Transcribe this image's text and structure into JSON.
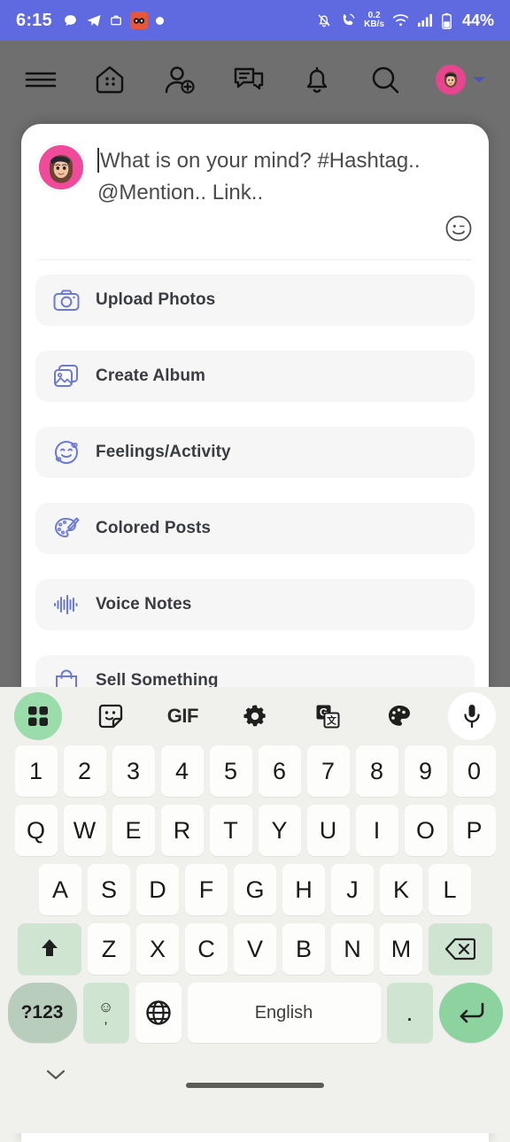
{
  "status_bar": {
    "time": "6:15",
    "network_speed": "0.2",
    "network_speed_unit": "KB/s",
    "battery": "44%",
    "background_color": "#5f6ae0",
    "left_icons": [
      "chat-bubble-icon",
      "telegram-icon",
      "camera-app-icon",
      "orange-app-icon",
      "dot-icon"
    ],
    "right_icons": [
      "bell-muted-icon",
      "call-icon",
      "network-speed",
      "wifi-icon",
      "signal-icon",
      "battery-icon"
    ]
  },
  "app_header": {
    "icons": [
      "menu-icon",
      "home-icon",
      "add-friend-icon",
      "messages-icon",
      "notifications-icon",
      "search-icon"
    ],
    "avatar": "user-avatar",
    "chevron": "chevron-down-icon"
  },
  "compose": {
    "placeholder": "What is on your mind? #Hashtag.. @Mention.. Link..",
    "placeholder_line1": "What is on your mind? #Hashtag..",
    "placeholder_line2": "@Mention.. Link..",
    "value": "",
    "emoji_button": "emoji-icon"
  },
  "options": [
    {
      "label": "Upload Photos",
      "icon": "camera-icon"
    },
    {
      "label": "Create Album",
      "icon": "photo-album-icon"
    },
    {
      "label": "Feelings/Activity",
      "icon": "smiley-face-icon"
    },
    {
      "label": "Colored Posts",
      "icon": "palette-brush-icon"
    },
    {
      "label": "Voice Notes",
      "icon": "waveform-icon"
    },
    {
      "label": "Sell Something",
      "icon": "shopping-bag-icon"
    }
  ],
  "icon_accent_color": "#6b7ad6",
  "keyboard": {
    "toolbar": [
      {
        "name": "apps-grid-icon",
        "label": ""
      },
      {
        "name": "sticker-icon",
        "label": ""
      },
      {
        "name": "gif-icon",
        "label": "GIF"
      },
      {
        "name": "gear-icon",
        "label": ""
      },
      {
        "name": "translate-icon",
        "label": ""
      },
      {
        "name": "palette-icon",
        "label": ""
      },
      {
        "name": "microphone-icon",
        "label": ""
      }
    ],
    "row_numbers": [
      "1",
      "2",
      "3",
      "4",
      "5",
      "6",
      "7",
      "8",
      "9",
      "0"
    ],
    "row_top": [
      "Q",
      "W",
      "E",
      "R",
      "T",
      "Y",
      "U",
      "I",
      "O",
      "P"
    ],
    "row_middle": [
      "A",
      "S",
      "D",
      "F",
      "G",
      "H",
      "J",
      "K",
      "L"
    ],
    "row_bottom": [
      "Z",
      "X",
      "C",
      "V",
      "B",
      "N",
      "M"
    ],
    "shift_key": "shift-icon",
    "backspace_key": "backspace-icon",
    "symbols_key": "?123",
    "emoji_key": "emoji-key",
    "emoji_key_sub": ",",
    "globe_key": "globe-icon",
    "space_key": "English",
    "period_key": ".",
    "enter_key": "enter-icon",
    "accent_color": "#8dd3a0"
  },
  "nav_bar": {
    "hide_keyboard": "chevron-down-icon",
    "gesture_bar": "home-gesture-bar"
  }
}
